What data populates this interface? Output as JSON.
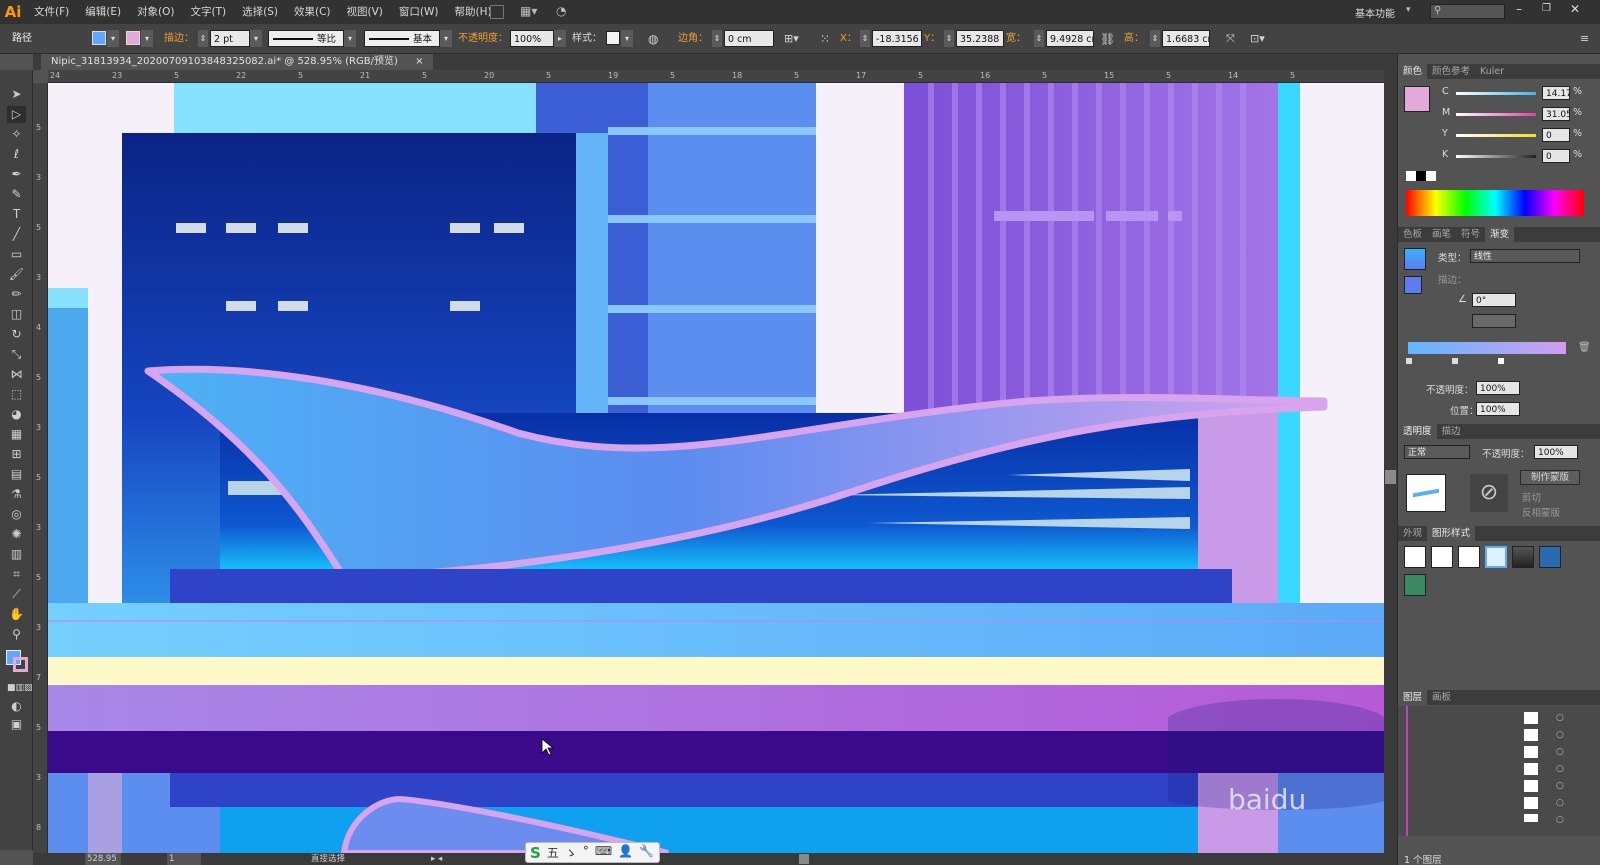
{
  "app": {
    "logo": "Ai"
  },
  "menu": [
    "文件(F)",
    "编辑(E)",
    "对象(O)",
    "文字(T)",
    "选择(S)",
    "效果(C)",
    "视图(V)",
    "窗口(W)",
    "帮助(H)"
  ],
  "workspace": {
    "label": "基本功能",
    "search_placeholder": ""
  },
  "control": {
    "selection": "路径",
    "stroke_label": "描边：",
    "stroke_value": "2 pt",
    "profile_label": "等比",
    "brush_label": "基本",
    "opacity_label": "不透明度：",
    "opacity_value": "100%",
    "style_label": "样式：",
    "corner_label": "边角：",
    "corner_value": "0 cm",
    "x_label": "X：",
    "x_value": "-18.3156",
    "y_label": "Y：",
    "y_value": "35.2388",
    "w_label": "宽：",
    "w_value": "9.4928 cm",
    "h_label": "高：",
    "h_value": "1.6683 cm"
  },
  "document": {
    "tab_title": "Nipic_31813934_20200709103848325082.ai* @ 528.95% (RGB/预览)",
    "close": "×"
  },
  "ruler_h": [
    "24",
    "23",
    "5",
    "22",
    "5",
    "21",
    "5",
    "20",
    "5",
    "19",
    "5",
    "18",
    "5",
    "17",
    "5",
    "16",
    "5",
    "15",
    "5",
    "14",
    "5"
  ],
  "ruler_v": [
    "5",
    "3",
    "5",
    "3",
    "4",
    "5",
    "3",
    "5",
    "3",
    "5",
    "3",
    "7",
    "5",
    "3",
    "8"
  ],
  "status": {
    "zoom": "528.95",
    "page": "1",
    "tool": "直接选择"
  },
  "color_panel": {
    "tabs": [
      "颜色",
      "颜色参考",
      "Kuler"
    ],
    "channels": [
      {
        "label": "C",
        "value": "14.17",
        "color": "#39b8e8"
      },
      {
        "label": "M",
        "value": "31.05",
        "color": "#e040a0"
      },
      {
        "label": "Y",
        "value": "0",
        "color": "#f0e020"
      },
      {
        "label": "K",
        "value": "0",
        "color": "#222222"
      }
    ],
    "fill_color": "#e4a9d9",
    "percent": "%"
  },
  "gradient_panel": {
    "tabs": [
      "色板",
      "画笔",
      "符号",
      "渐变"
    ],
    "type_label": "类型：",
    "type_value": "线性",
    "stroke_label": "描边：",
    "angle_value": "0°",
    "opacity_label": "不透明度：",
    "opacity_value": "100%",
    "position_label": "位置：",
    "position_value": "100%",
    "start_color": "#5fb8ff",
    "end_color": "#d39cf0"
  },
  "transparency_panel": {
    "tabs": [
      "透明度",
      "描边"
    ],
    "mode": "正常",
    "opacity_label": "不透明度：",
    "opacity_value": "100%",
    "make_mask": "制作蒙版",
    "clip": "剪切",
    "invert": "反相蒙版"
  },
  "graphic_styles_panel": {
    "tabs": [
      "外观",
      "图形样式"
    ]
  },
  "layers_panel": {
    "tabs": [
      "图层",
      "画板"
    ],
    "count": "1 个图层"
  },
  "canvas": {
    "colors": {
      "navy": "#0d2a8a",
      "sky": "#5fc0ff",
      "purple": "#9a6fe0",
      "cream": "#fff8c8",
      "deep": "#3a0a8a"
    }
  },
  "ime": {
    "items": [
      "五",
      "ゝ",
      "°",
      "⌨",
      "👤",
      "🔧"
    ]
  },
  "watermark": "baidu"
}
